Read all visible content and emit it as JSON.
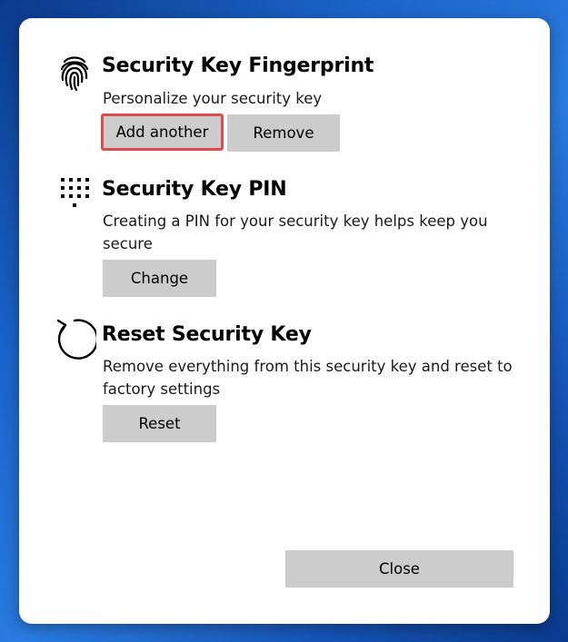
{
  "fingerprint": {
    "icon": "fingerprint-icon",
    "title": "Security Key Fingerprint",
    "description": "Personalize your security key",
    "add_label": "Add another",
    "remove_label": "Remove"
  },
  "pin": {
    "icon": "keypad-icon",
    "title": "Security Key PIN",
    "description": "Creating a PIN for your security key helps keep you secure",
    "change_label": "Change"
  },
  "reset": {
    "icon": "reset-icon",
    "title": "Reset Security Key",
    "description": "Remove everything from this security key and reset to factory settings",
    "reset_label": "Reset"
  },
  "close_label": "Close",
  "colors": {
    "button_bg": "#cccccc",
    "focus_ring": "#e04a4a",
    "dialog_bg": "#ffffff"
  }
}
